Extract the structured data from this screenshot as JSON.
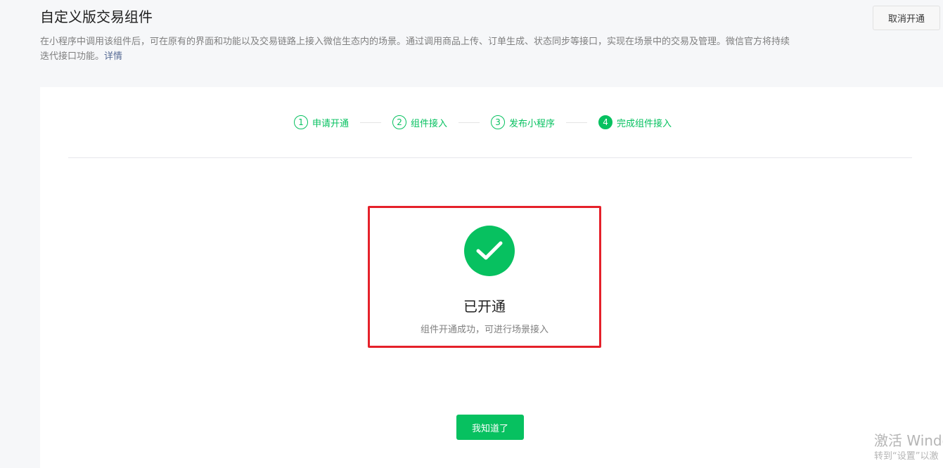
{
  "header": {
    "title": "自定义版交易组件",
    "cancel_label": "取消开通"
  },
  "description": {
    "text": "在小程序中调用该组件后，可在原有的界面和功能以及交易链路上接入微信生态内的场景。通过调用商品上传、订单生成、状态同步等接口，实现在场景中的交易及管理。微信官方将持续迭代接口功能。",
    "link_label": "详情"
  },
  "steps": [
    {
      "num": "1",
      "label": "申请开通",
      "state": "done"
    },
    {
      "num": "2",
      "label": "组件接入",
      "state": "done"
    },
    {
      "num": "3",
      "label": "发布小程序",
      "state": "done"
    },
    {
      "num": "4",
      "label": "完成组件接入",
      "state": "active"
    }
  ],
  "result": {
    "icon": "checkmark-icon",
    "title": "已开通",
    "description": "组件开通成功，可进行场景接入"
  },
  "actions": {
    "ok_label": "我知道了"
  },
  "watermark": {
    "line1": "激活 Windo",
    "line2": "转到“设置”以激"
  },
  "colors": {
    "accent": "#07c160",
    "highlight": "#e5212a",
    "link": "#576b95"
  }
}
